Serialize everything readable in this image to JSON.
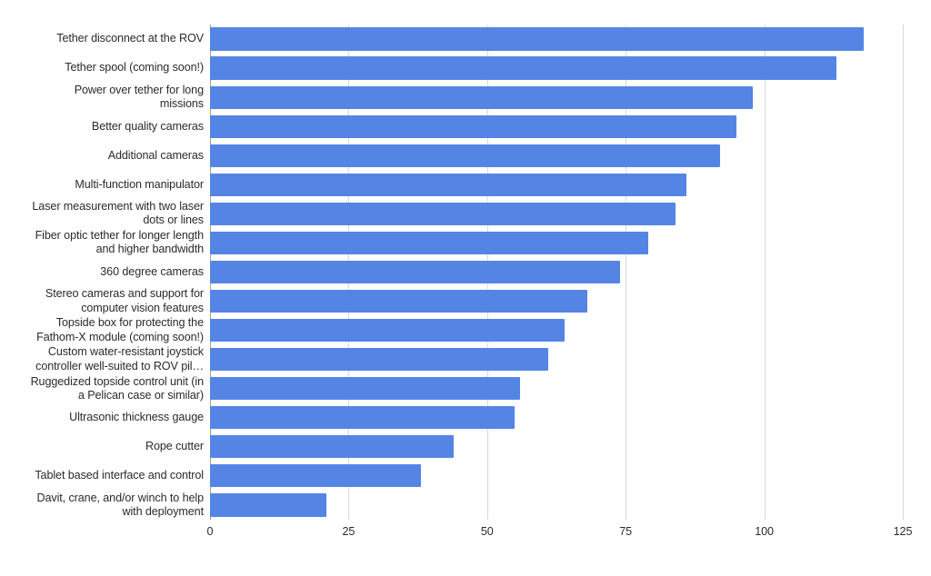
{
  "chart_data": {
    "type": "bar",
    "orientation": "horizontal",
    "title": "",
    "subtitle": "",
    "xlabel": "",
    "ylabel": "",
    "xlim": [
      0,
      125
    ],
    "xticks": [
      "0",
      "25",
      "50",
      "75",
      "100",
      "125"
    ],
    "xtick_values": [
      0,
      25,
      50,
      75,
      100,
      125
    ],
    "grid": "vertical",
    "legend": "none",
    "bar_color": "#5585e4",
    "gridline_color": "#d9d9d9",
    "axis_color": "#9aa0a6",
    "label_color": "#2b2b2b",
    "categories": [
      "Tether disconnect at the ROV",
      "Tether spool (coming soon!)",
      "Power over tether for long\nmissions",
      "Better quality cameras",
      "Additional cameras",
      "Multi-function manipulator",
      "Laser measurement with two laser\ndots or lines",
      "Fiber optic tether for longer length\nand higher bandwidth",
      "360 degree cameras",
      "Stereo cameras and support for\ncomputer vision features",
      "Topside box for protecting the\nFathom-X module (coming soon!)",
      "Custom water-resistant joystick\ncontroller well-suited to ROV pil…",
      "Ruggedized topside control unit (in\na Pelican case or similar)",
      "Ultrasonic thickness gauge",
      "Rope cutter",
      "Tablet based interface and control",
      "Davit, crane, and/or winch to help\nwith deployment"
    ],
    "values": [
      118,
      113,
      98,
      95,
      92,
      86,
      84,
      79,
      74,
      68,
      64,
      61,
      56,
      55,
      44,
      38,
      21
    ]
  }
}
